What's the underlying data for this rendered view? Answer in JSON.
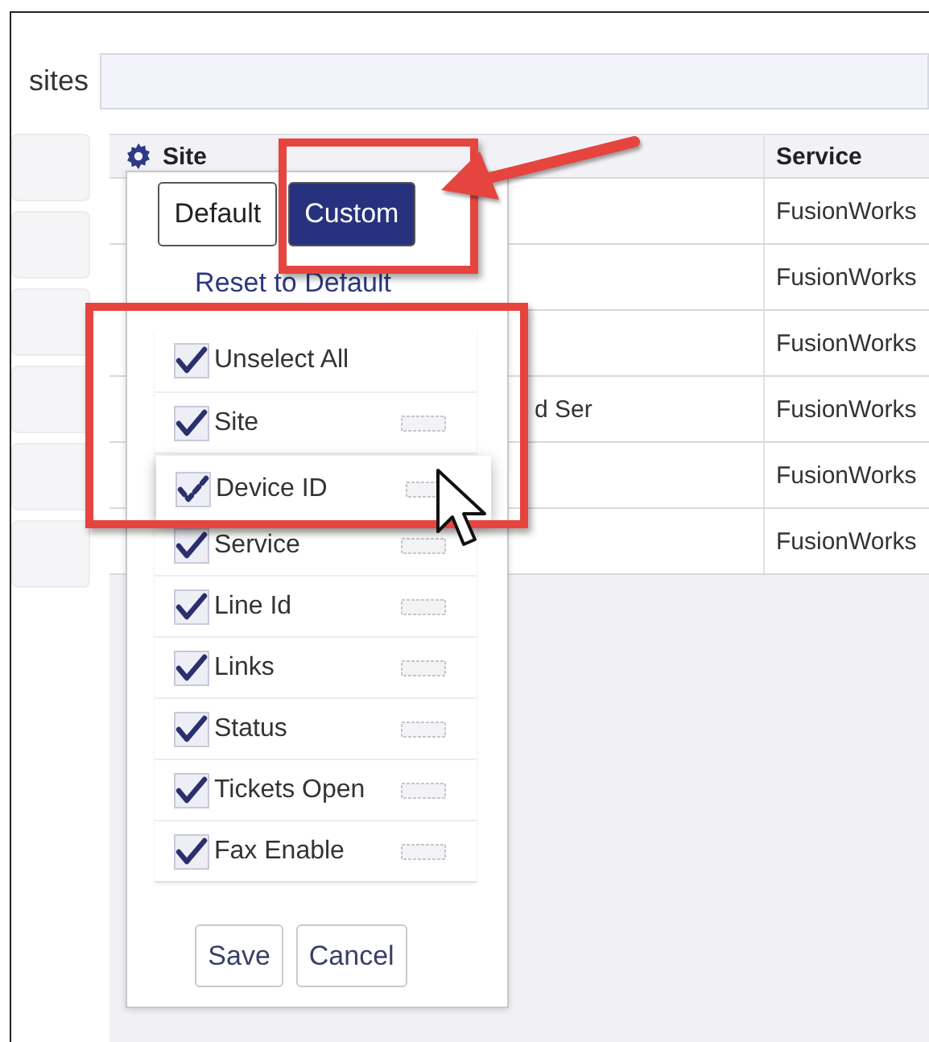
{
  "filter": {
    "label": "sites"
  },
  "table": {
    "columns": [
      {
        "kind": "settings",
        "label": "Site"
      },
      {
        "kind": "plain",
        "label": "Service"
      }
    ],
    "rows": [
      {
        "service": "FusionWorks"
      },
      {
        "service": "FusionWorks"
      },
      {
        "service": "FusionWorks"
      },
      {
        "column_2": "d Ser",
        "service": "FusionWorks"
      },
      {
        "service": "FusionWorks"
      },
      {
        "service": "FusionWorks"
      }
    ]
  },
  "column_picker": {
    "modes": [
      {
        "label": "Default",
        "selected": false
      },
      {
        "label": "Custom",
        "selected": true
      }
    ],
    "reset_link": "Reset to Default",
    "select_all": {
      "label": "Unselect All",
      "checked": true
    },
    "columns": [
      {
        "kind": "item",
        "label": "Site",
        "checked": true
      },
      {
        "kind": "dragging",
        "label": "Device ID",
        "checked": true
      },
      {
        "kind": "item",
        "label": "Service",
        "checked": true
      },
      {
        "kind": "item",
        "label": "Line Id",
        "checked": true
      },
      {
        "kind": "item",
        "label": "Links",
        "checked": true
      },
      {
        "kind": "item",
        "label": "Status",
        "checked": true
      },
      {
        "kind": "item",
        "label": "Tickets Open",
        "checked": true
      },
      {
        "kind": "item",
        "label": "Fax Enable",
        "checked": true
      }
    ],
    "buttons": [
      "Save",
      "Cancel"
    ]
  }
}
